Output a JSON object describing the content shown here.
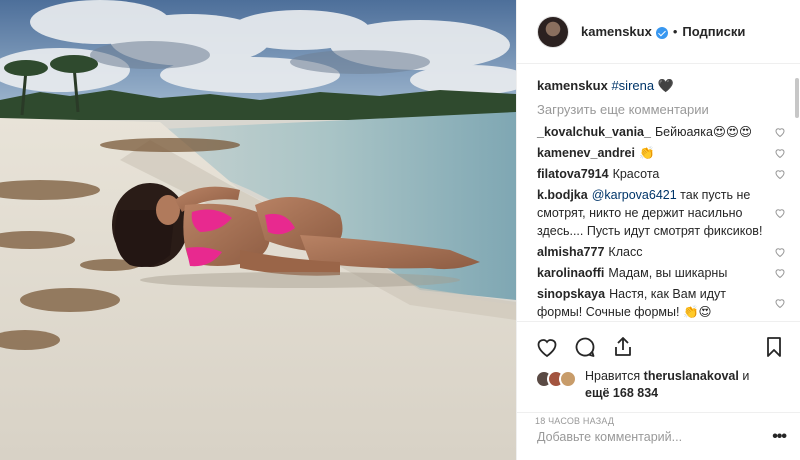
{
  "header": {
    "username": "kamenskux",
    "separator": "•",
    "follow_label": "Подписки"
  },
  "caption": {
    "username": "kamenskux",
    "hashtag": "#sirena",
    "emoji": "🖤"
  },
  "load_more_label": "Загрузить еще комментарии",
  "comments": [
    {
      "user": "_kovalchuk_vania_",
      "text": "Бейюаяка😍😍😍"
    },
    {
      "user": "kamenev_andrei",
      "text": "👏"
    },
    {
      "user": "filatova7914",
      "text": "Красота"
    },
    {
      "user": "k.bodjka",
      "mention": "@karpova6421",
      "text": "так пусть не смотрят, никто не держит насильно здесь.... Пусть идут смотрят фиксиков!"
    },
    {
      "user": "almisha777",
      "text": "Класс"
    },
    {
      "user": "karolinaoffi",
      "text": "Мадам, вы шикарны"
    },
    {
      "user": "sinopskaya",
      "text": "Настя, как Вам идут формы! Сочные формы! 👏😍"
    }
  ],
  "likes": {
    "prefix": "Нравится",
    "user": "theruslanakoval",
    "conj": "и",
    "more": "ещё 168 834"
  },
  "timestamp": "18 часов назад",
  "add_comment": {
    "placeholder": "Добавьте комментарий...",
    "menu_label": "•••"
  },
  "icons": [
    "heart-icon",
    "comment-icon",
    "share-icon",
    "bookmark-icon",
    "verified-badge-icon",
    "more-options-icon"
  ],
  "colors": {
    "link": "#003569",
    "verified": "#3897f0",
    "muted": "#999999",
    "text": "#262626",
    "bikini": "#e8298f"
  }
}
